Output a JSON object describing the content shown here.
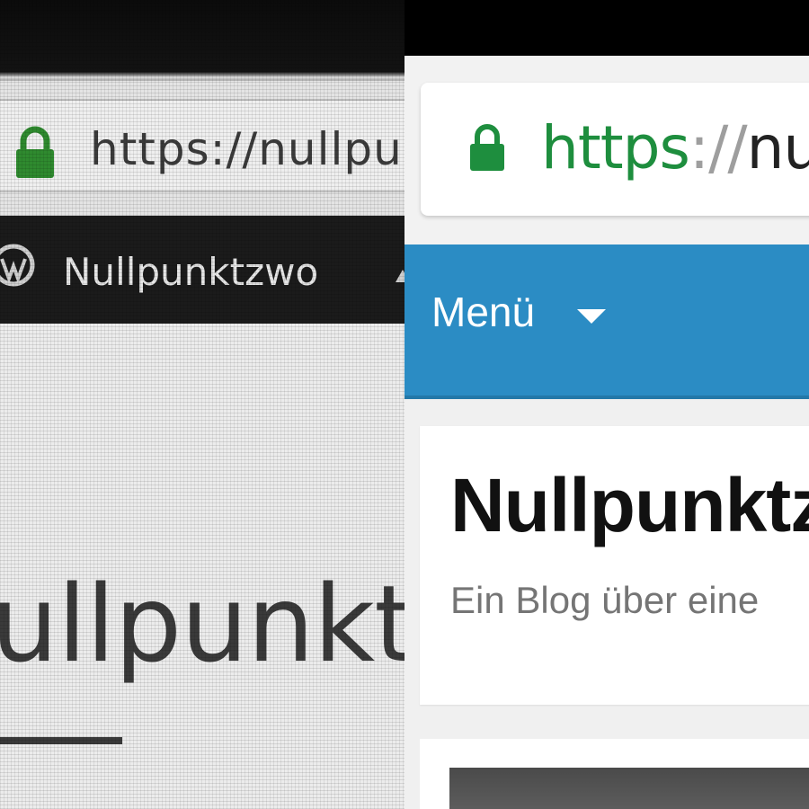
{
  "left_screen": {
    "address_bar": {
      "url": "https://nullpu"
    },
    "admin_bar": {
      "site_name": "Nullpunktzwo"
    },
    "content": {
      "headline": "ullpunkt"
    }
  },
  "right_screen": {
    "address_bar": {
      "url_scheme": "https",
      "url_separator": "://",
      "url_host": "nul"
    },
    "nav": {
      "menu_label": "Menü"
    },
    "header": {
      "site_title": "Nullpunktz",
      "tagline": "Ein Blog über eine"
    }
  },
  "colors": {
    "lock_green": "#1e8e3e",
    "nav_blue": "#2b8cc4",
    "admin_bar_dark": "#1b1b1b"
  },
  "icons": [
    "info-icon",
    "lock-icon",
    "wordpress-icon",
    "caret-down-icon"
  ]
}
